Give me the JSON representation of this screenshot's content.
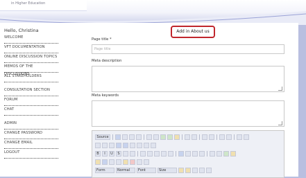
{
  "brand": {
    "text": "in Higher Education"
  },
  "sidebar": {
    "greeting": "Hello, Christina",
    "items": [
      "WELCOME",
      "VFT DOCUMENTATION",
      "ONLINE DISCUSSION TOPICS",
      "MEMOS OF THE DISCUSSIONS",
      "ALL STAKEHOLDERS",
      "CONSULTATION SECTION",
      "FORUM",
      "CHAT",
      "ADMIN",
      "CHANGE PASSWORD",
      "CHANGE EMAIL",
      "LOGOUT"
    ]
  },
  "header": {
    "add_button": "Add in About us"
  },
  "form": {
    "page_title_label": "Page title *",
    "page_title_placeholder": "Page title",
    "meta_description_label": "Meta description",
    "meta_keywords_label": "Meta keywords"
  },
  "editor": {
    "source_label": "Source",
    "format_label": "Form",
    "normal_label": "Normal",
    "font_label": "Font",
    "size_label": "Size"
  }
}
